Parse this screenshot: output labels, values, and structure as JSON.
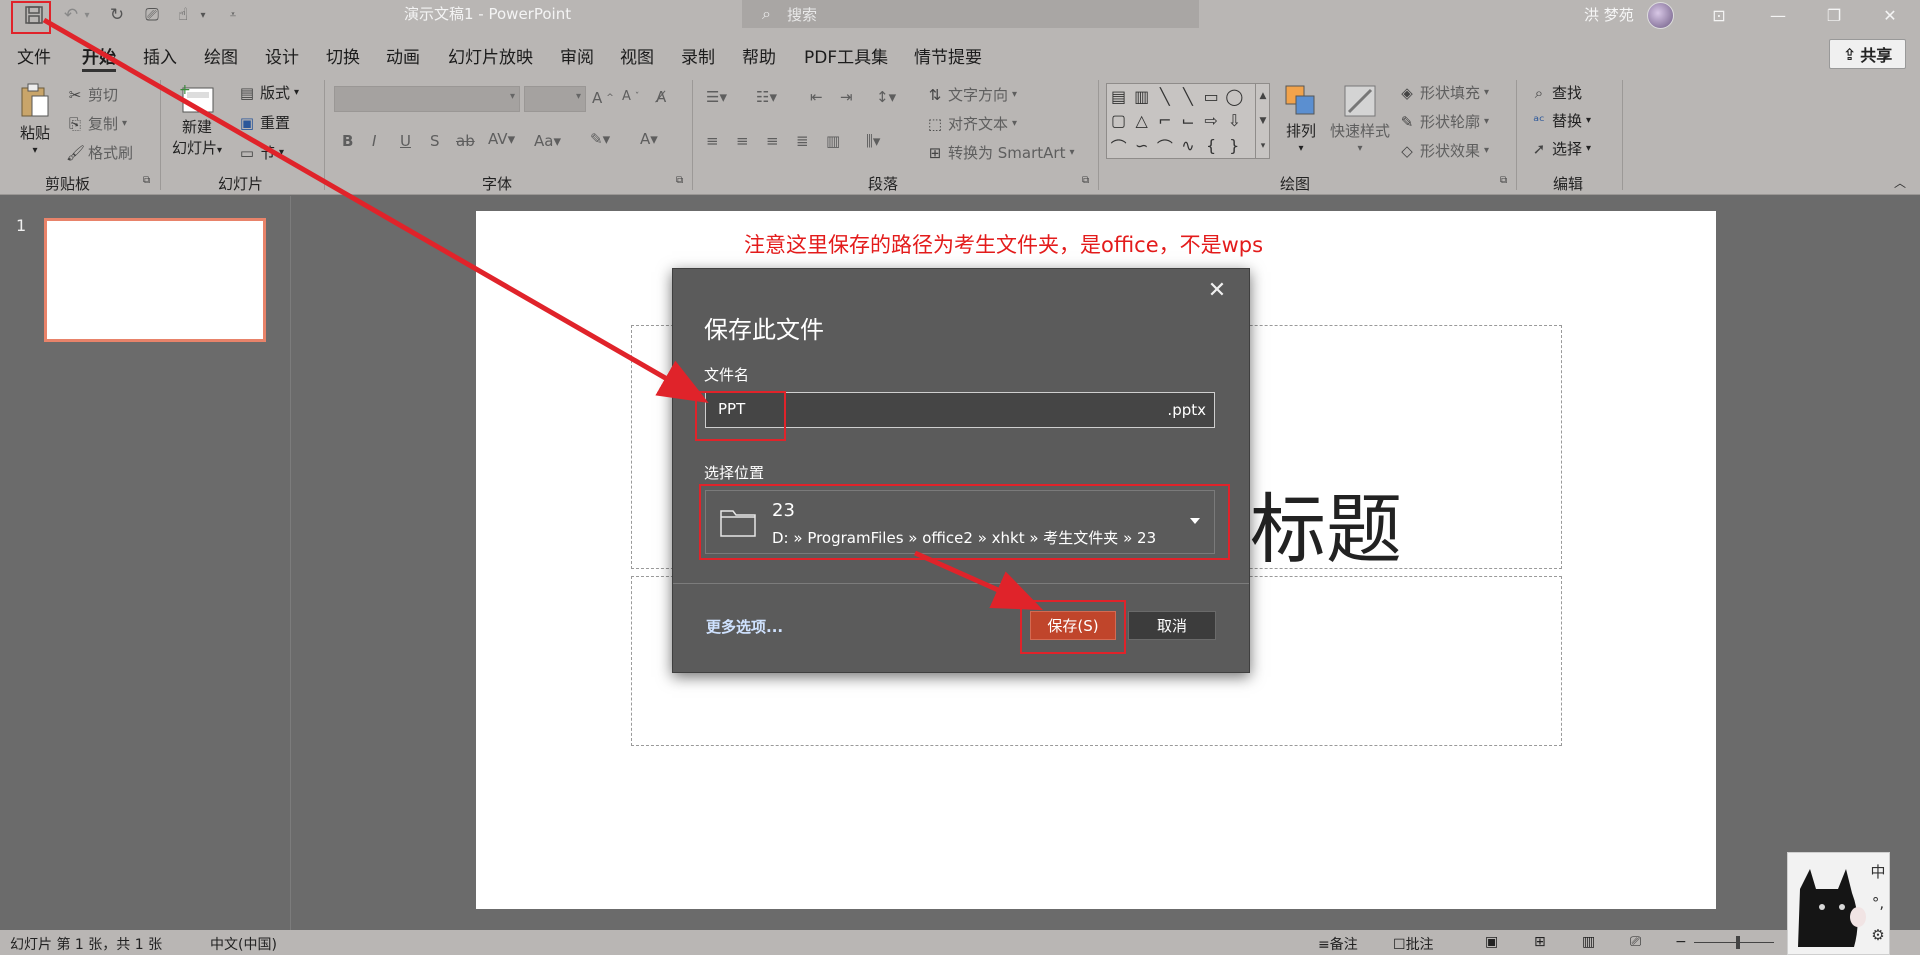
{
  "titlebar": {
    "doc_title": "演示文稿1  -  PowerPoint",
    "search_placeholder": "搜索",
    "user_name": "洪 梦苑"
  },
  "menu": {
    "tabs": [
      "文件",
      "开始",
      "插入",
      "绘图",
      "设计",
      "切换",
      "动画",
      "幻灯片放映",
      "审阅",
      "视图",
      "录制",
      "帮助",
      "PDF工具集",
      "情节提要"
    ],
    "share_label": "共享"
  },
  "ribbon": {
    "clipboard": {
      "paste": "粘贴",
      "cut": "剪切",
      "copy": "复制",
      "format_painter": "格式刷",
      "group": "剪贴板"
    },
    "slides": {
      "new_slide_line1": "新建",
      "new_slide_line2": "幻灯片",
      "layout": "版式",
      "reset": "重置",
      "section": "节",
      "group": "幻灯片"
    },
    "font": {
      "group": "字体"
    },
    "paragraph": {
      "text_direction": "文字方向",
      "align_text": "对齐文本",
      "smartart": "转换为 SmartArt",
      "group": "段落"
    },
    "drawing": {
      "arrange": "排列",
      "quick_styles": "快速样式",
      "shape_fill": "形状填充",
      "shape_outline": "形状轮廓",
      "shape_effects": "形状效果",
      "group": "绘图"
    },
    "editing": {
      "find": "查找",
      "replace": "替换",
      "select": "选择",
      "group": "编辑"
    }
  },
  "thumbnails": {
    "slide_number": "1"
  },
  "slide": {
    "annotation": "注意这里保存的路径为考生文件夹，是office，不是wps",
    "title_placeholder": "标题"
  },
  "dialog": {
    "title": "保存此文件",
    "filename_label": "文件名",
    "filename_value": "PPT",
    "extension": ".pptx",
    "location_label": "选择位置",
    "location_folder": "23",
    "location_path": "D: » ProgramFiles » office2 » xhkt » 考生文件夹 » 23",
    "more_options": "更多选项...",
    "save_label": "保存(S)",
    "cancel_label": "取消"
  },
  "statusbar": {
    "slide_info": "幻灯片 第 1 张，共 1 张",
    "language": "中文(中国)",
    "notes": "备注",
    "comments": "批注"
  },
  "ime": {
    "mode": "中",
    "punct": "°,",
    "tool": "⚙"
  }
}
